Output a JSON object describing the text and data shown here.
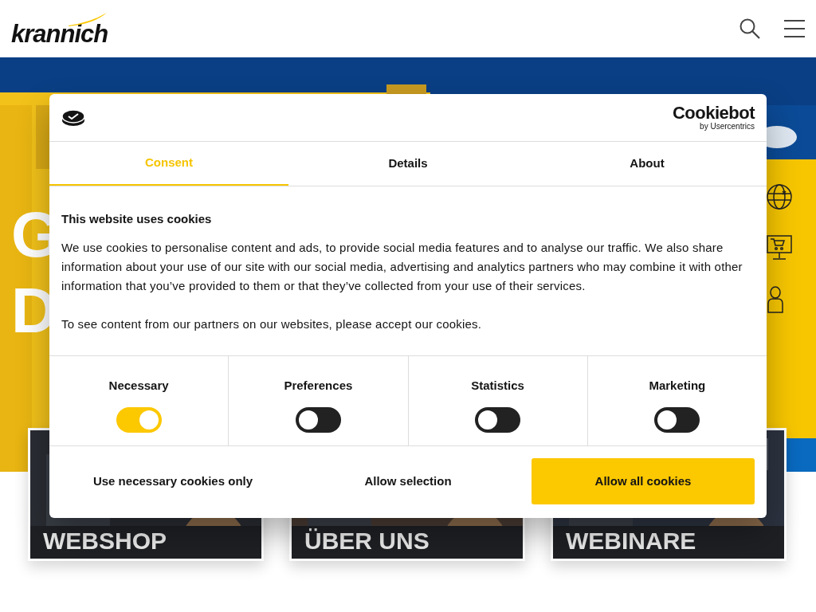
{
  "header": {
    "logo": "krannich"
  },
  "hero": {
    "heading_visible": [
      "G",
      "D"
    ]
  },
  "cards": [
    {
      "title": "WEBSHOP"
    },
    {
      "title": "ÜBER UNS"
    },
    {
      "title": "WEBINARE"
    }
  ],
  "cookie_dialog": {
    "brand": "Cookiebot",
    "brand_sub": "by Usercentrics",
    "tabs": [
      {
        "label": "Consent",
        "selected": true
      },
      {
        "label": "Details",
        "selected": false
      },
      {
        "label": "About",
        "selected": false
      }
    ],
    "heading": "This website uses cookies",
    "paragraphs": [
      "We use cookies to personalise content and ads, to provide social media features and to analyse our traffic. We also share information about your use of our site with our social media, advertising and analytics partners who may combine it with other information that you’ve provided to them or that they’ve collected from your use of their services.",
      "To see content from our partners on our websites, please accept our cookies."
    ],
    "categories": [
      {
        "label": "Necessary",
        "on": true
      },
      {
        "label": "Preferences",
        "on": false
      },
      {
        "label": "Statistics",
        "on": false
      },
      {
        "label": "Marketing",
        "on": false
      }
    ],
    "buttons": [
      {
        "label": "Use necessary cookies only",
        "kind": "plain"
      },
      {
        "label": "Allow selection",
        "kind": "plain"
      },
      {
        "label": "Allow all cookies",
        "kind": "primary"
      }
    ]
  }
}
